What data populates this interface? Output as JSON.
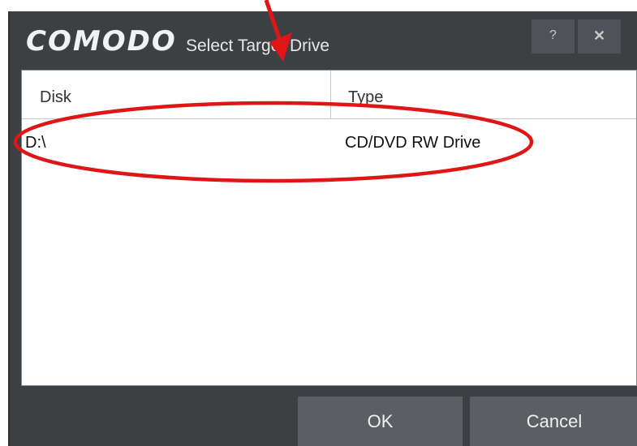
{
  "app": {
    "brand": "COMODO",
    "title": "Select Target Drive"
  },
  "window_buttons": {
    "help": "?",
    "close": "✕"
  },
  "table": {
    "columns": [
      "Disk",
      "Type"
    ],
    "rows": [
      {
        "disk": "D:\\",
        "type": "CD/DVD RW Drive"
      }
    ]
  },
  "buttons": {
    "ok": "OK",
    "cancel": "Cancel"
  },
  "annotation": {
    "color": "#e01616"
  }
}
